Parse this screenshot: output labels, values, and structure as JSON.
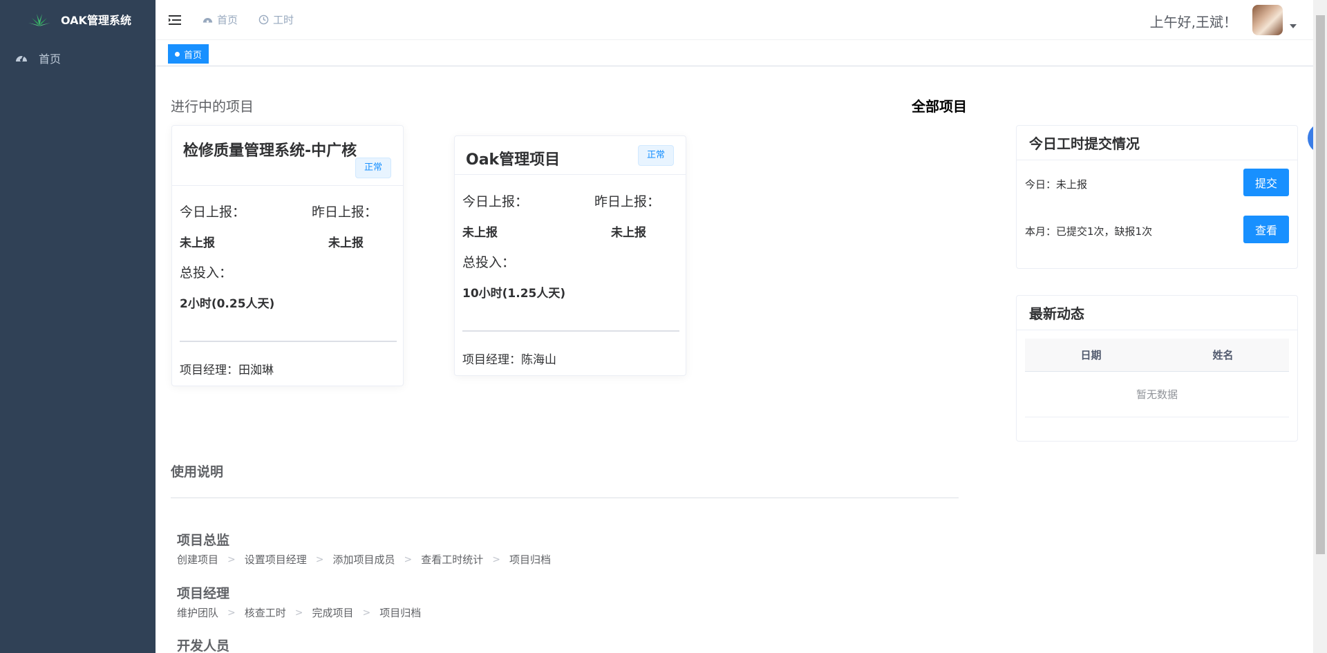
{
  "app": {
    "title": "OAK管理系统"
  },
  "sidebar": {
    "items": [
      {
        "label": "首页",
        "icon": "dashboard-icon"
      }
    ]
  },
  "header": {
    "nav": [
      {
        "label": "首页",
        "icon": "dashboard-icon"
      },
      {
        "label": "工时",
        "icon": "clock-icon"
      }
    ],
    "greeting": "上午好,王斌！"
  },
  "tags": {
    "active": "首页"
  },
  "projects": {
    "section_title": "进行中的项目",
    "all_link": "全部项目",
    "labels": {
      "today": "今日上报：",
      "yesterday": "昨日上报：",
      "total": "总投入："
    },
    "items": [
      {
        "name": "检修质量管理系统-中广核",
        "status": "正常",
        "today": "未上报",
        "yesterday": "未上报",
        "total": "2小时(0.25人天)",
        "manager": "项目经理：田洳琳"
      },
      {
        "name": "Oak管理项目",
        "status": "正常",
        "today": "未上报",
        "yesterday": "未上报",
        "total": "10小时(1.25人天)",
        "manager": "项目经理：陈海山"
      }
    ]
  },
  "worklog": {
    "title": "今日工时提交情况",
    "today_text": "今日：未上报",
    "month_text": "本月：已提交1次，缺报1次",
    "submit_label": "提交",
    "view_label": "查看"
  },
  "activity": {
    "title": "最新动态",
    "columns": [
      "日期",
      "姓名"
    ],
    "empty_text": "暂无数据"
  },
  "usage": {
    "title": "使用说明",
    "roles": [
      {
        "title": "项目总监",
        "steps": [
          "创建项目",
          "设置项目经理",
          "添加项目成员",
          "查看工时统计",
          "项目归档"
        ]
      },
      {
        "title": "项目经理",
        "steps": [
          "维护团队",
          "核查工时",
          "完成项目",
          "项目归档"
        ]
      },
      {
        "title": "开发人员",
        "steps": []
      }
    ]
  },
  "colors": {
    "sidebar_bg": "#304156",
    "primary": "#1890ff"
  }
}
